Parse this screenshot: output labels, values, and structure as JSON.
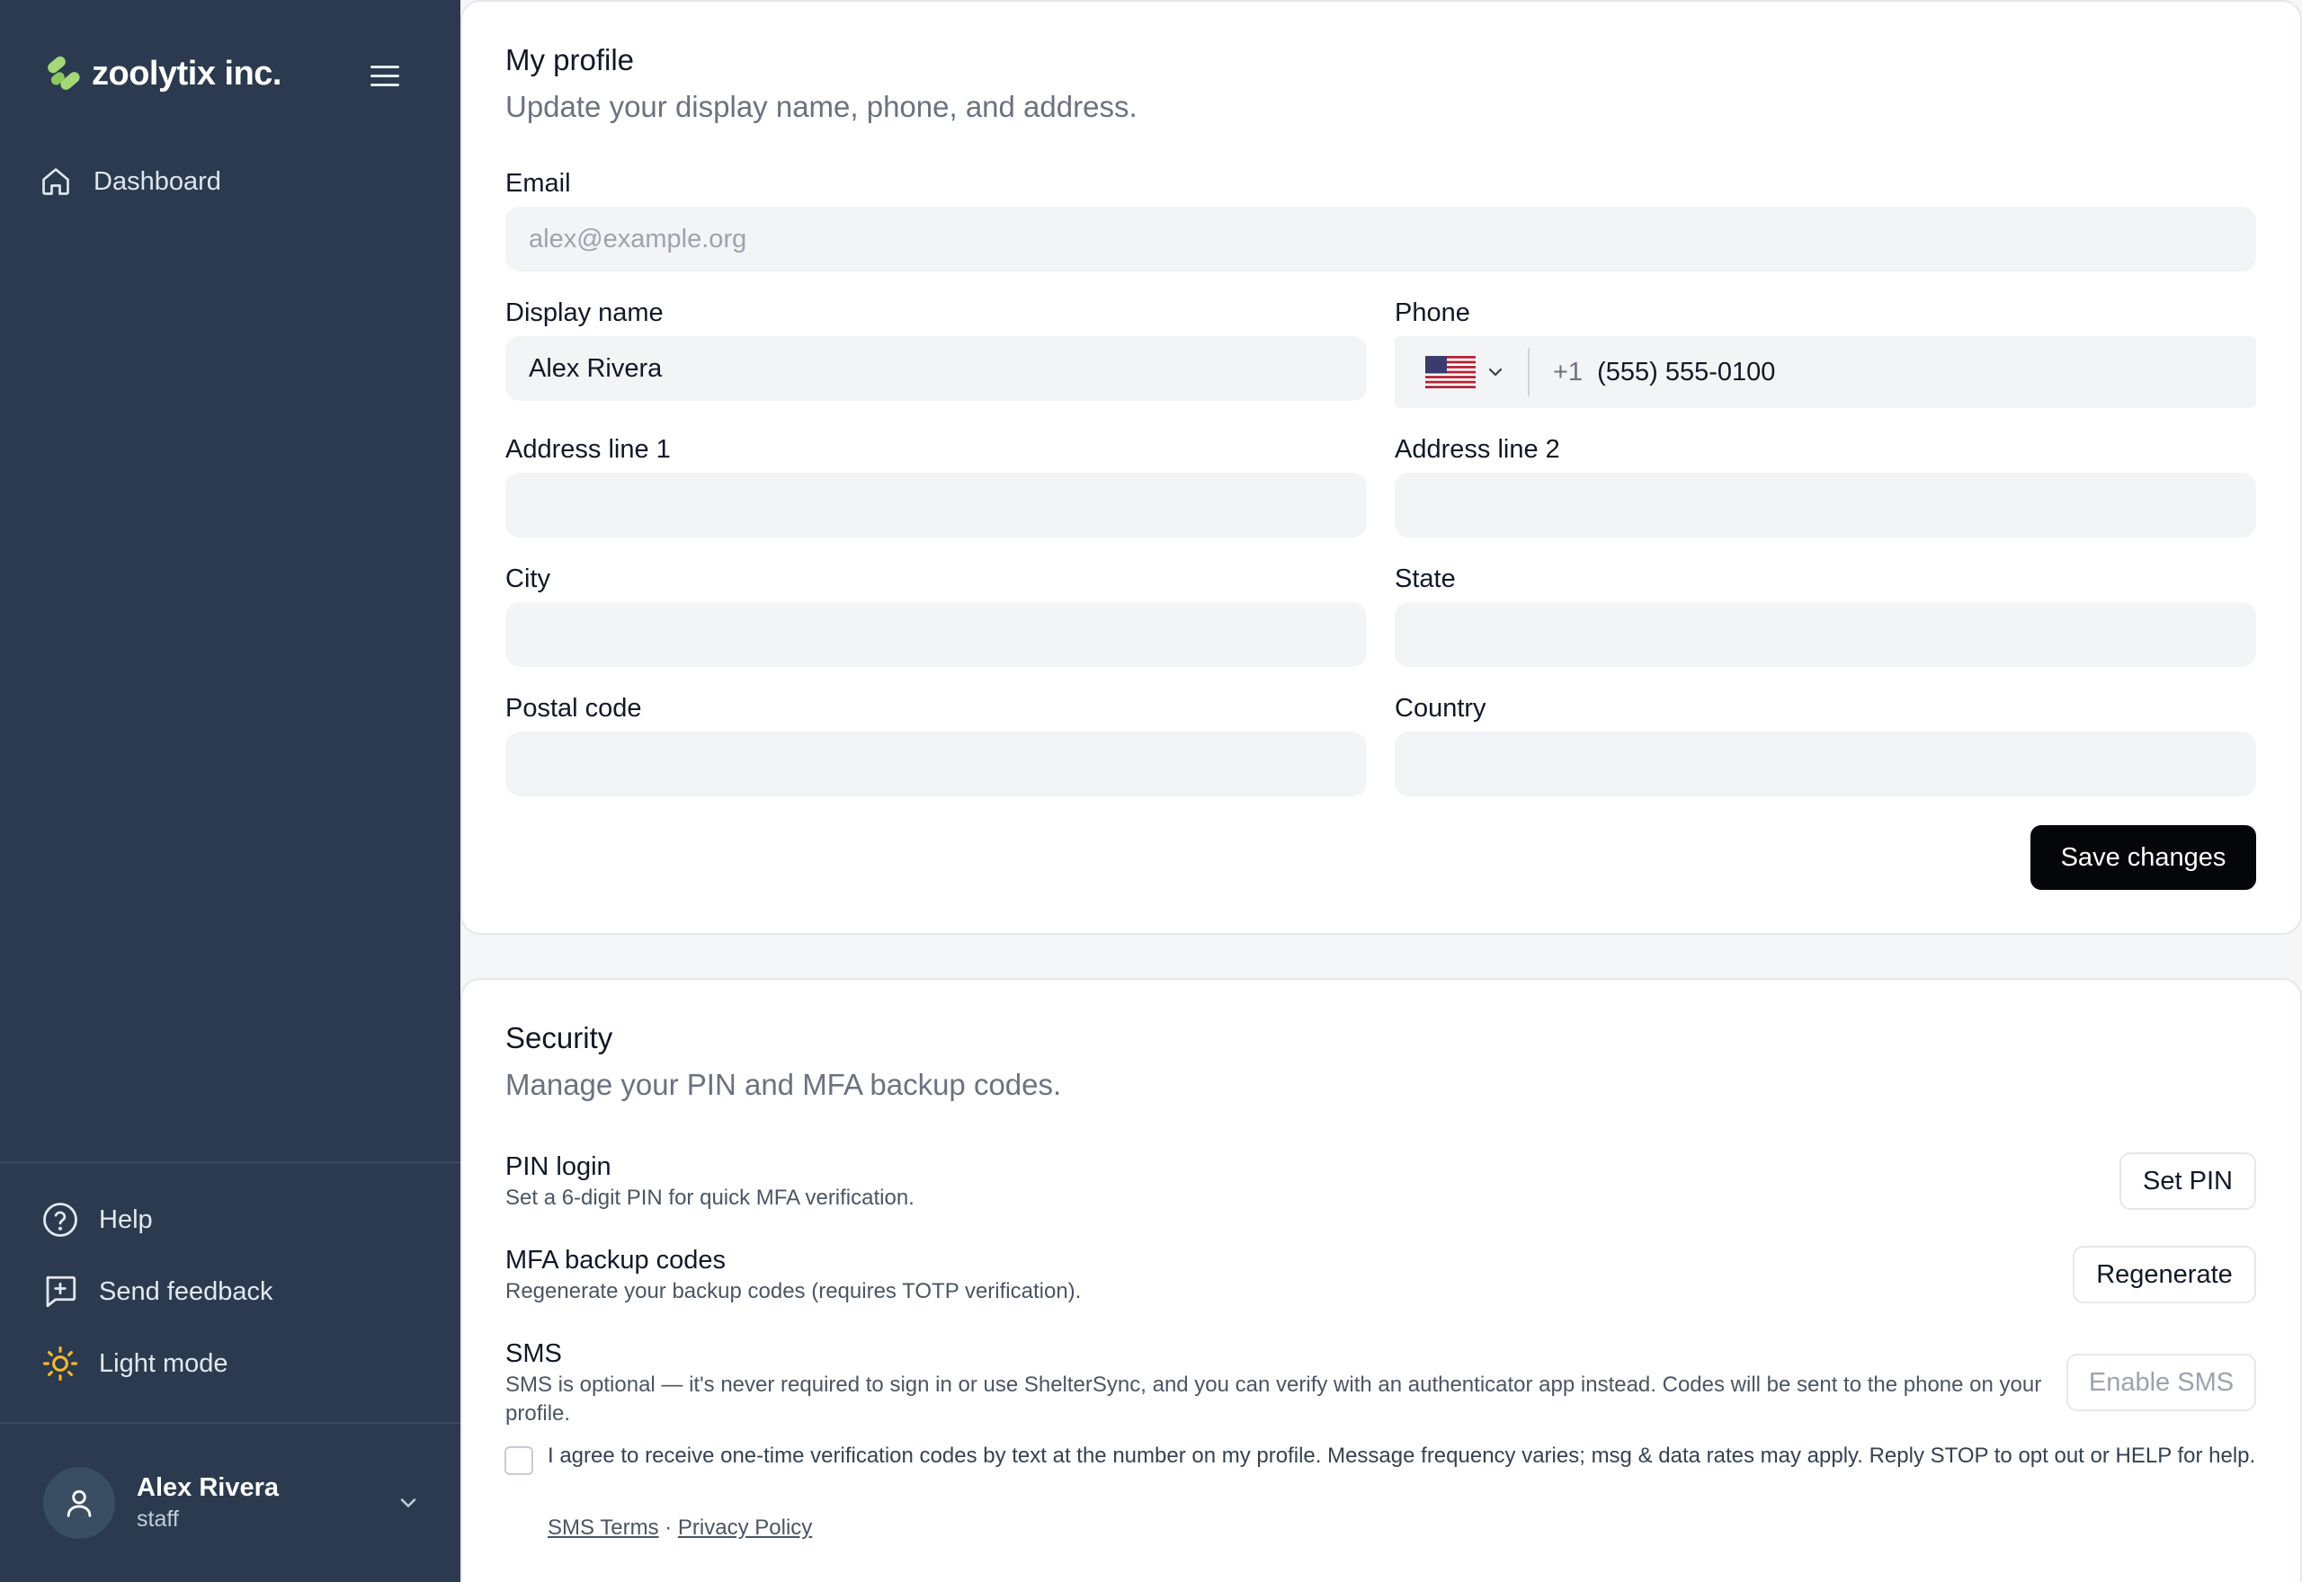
{
  "brand": {
    "name": "zoolytix inc."
  },
  "nav": {
    "dashboard": "Dashboard"
  },
  "footer_nav": {
    "help": "Help",
    "feedback": "Send feedback",
    "theme": "Light mode"
  },
  "user": {
    "name": "Alex Rivera",
    "role": "staff"
  },
  "profile": {
    "title": "My profile",
    "subtitle": "Update your display name, phone, and address.",
    "email_label": "Email",
    "email_placeholder": "alex@example.org",
    "display_name_label": "Display name",
    "display_name_value": "Alex Rivera",
    "phone_label": "Phone",
    "phone_code": "+1",
    "phone_value": "(555) 555-0100",
    "address1_label": "Address line 1",
    "address2_label": "Address line 2",
    "city_label": "City",
    "state_label": "State",
    "postal_label": "Postal code",
    "country_label": "Country",
    "save_label": "Save changes"
  },
  "security": {
    "title": "Security",
    "subtitle": "Manage your PIN and MFA backup codes.",
    "pin_title": "PIN login",
    "pin_desc": "Set a 6-digit PIN for quick MFA verification.",
    "pin_button": "Set PIN",
    "mfa_title": "MFA backup codes",
    "mfa_desc": "Regenerate your backup codes (requires TOTP verification).",
    "mfa_button": "Regenerate",
    "sms_title": "SMS",
    "sms_desc": "SMS is optional — it's never required to sign in or use ShelterSync, and you can verify with an authenticator app instead. Codes will be sent to the phone on your profile.",
    "sms_button": "Enable SMS",
    "consent": "I agree to receive one-time verification codes by text at the number on my profile. Message frequency varies; msg & data rates may apply. Reply STOP to opt out or HELP for help.",
    "sms_terms": "SMS Terms",
    "separator": "·",
    "privacy": "Privacy Policy"
  },
  "colors": {
    "sidebar": "#2b3a4e",
    "brand_leaf": "#a3d977",
    "sun": "#f5b82e",
    "primary_button": "#05060a"
  }
}
